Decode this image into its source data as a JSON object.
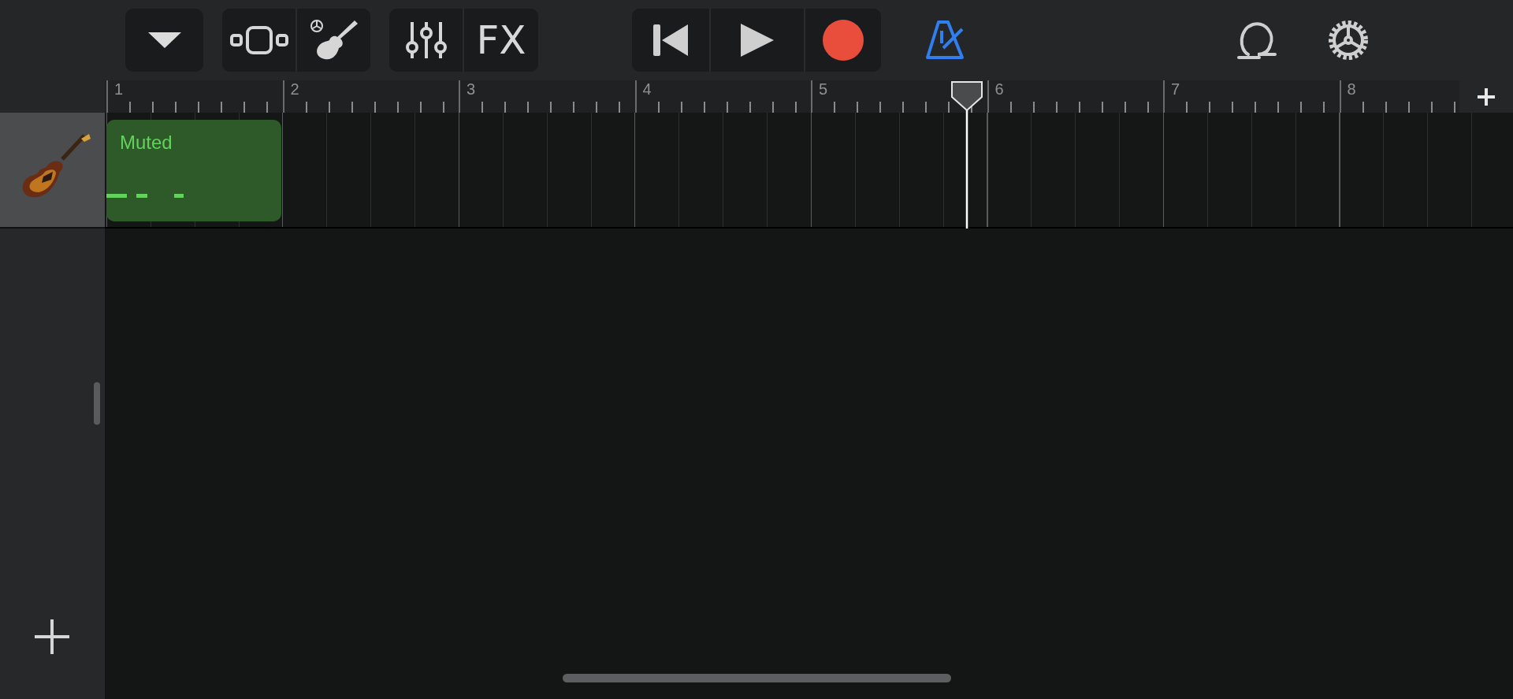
{
  "toolbar": {
    "fx_label": "FX",
    "metronome": {
      "on": true
    }
  },
  "ruler": {
    "bars": [
      "1",
      "2",
      "3",
      "4",
      "5",
      "6",
      "7",
      "8"
    ]
  },
  "tracks": [
    {
      "regions": [
        {
          "label": "Muted"
        }
      ]
    }
  ]
}
